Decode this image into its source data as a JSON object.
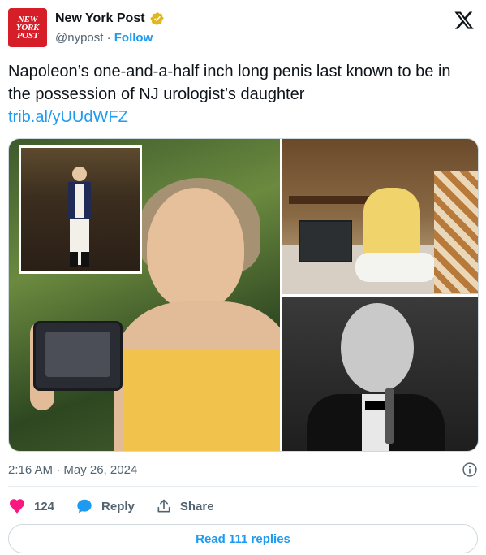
{
  "account": {
    "logo_lines": [
      "NEW",
      "YORK",
      "POST"
    ],
    "name": "New York Post",
    "handle": "@nypost",
    "separator": "·",
    "follow_label": "Follow",
    "verified_icon": "verified-badge-icon"
  },
  "platform_logo": "x-logo",
  "tweet": {
    "text": "Napoleon’s one-and-a-half inch long penis last known to be in the possession of NJ urologist’s daughter",
    "link": "trib.al/yUUdWFZ"
  },
  "media": {
    "image_count": 3
  },
  "meta": {
    "timestamp": "2:16 AM · May 26, 2024"
  },
  "actions": {
    "likes_count": "124",
    "reply_label": "Reply",
    "share_label": "Share"
  },
  "read_replies_label": "Read 111 replies",
  "colors": {
    "accent": "#1d9bf0",
    "like": "#f91880",
    "brand_red": "#d51e28",
    "verified_gold": "#e2b719",
    "secondary_text": "#536471"
  }
}
